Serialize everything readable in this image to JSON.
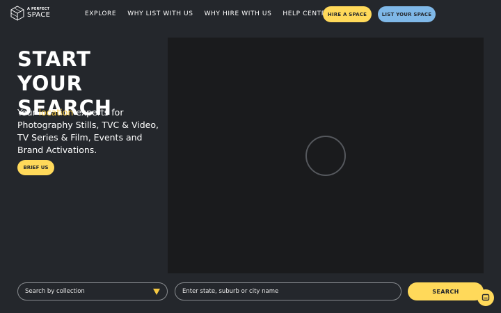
{
  "header": {
    "logo": {
      "line1": "A PERFECT",
      "line2": "SPACE",
      "icon": "cube-logo-icon"
    },
    "nav": [
      {
        "label": "EXPLORE"
      },
      {
        "label": "WHY LIST WITH US"
      },
      {
        "label": "WHY HIRE WITH US"
      },
      {
        "label": "HELP CENTRE"
      }
    ],
    "hire_button": "HIRE A SPACE",
    "list_button": "LIST YOUR SPACE"
  },
  "hero": {
    "title_line1": "START YOUR",
    "title_line2": "SEARCH",
    "desc_prefix": "Your ",
    "desc_highlight": "location",
    "desc_rest": " experts for Photography Stills, TVC & Video, TV Series & Film, Events and Brand Activations.",
    "brief_button": "BRIEF US"
  },
  "video": {
    "loading_icon": "spinner-icon"
  },
  "search": {
    "collection_placeholder": "Search by collection",
    "location_placeholder": "Enter state, suburb or city name",
    "search_button": "SEARCH"
  },
  "chat": {
    "icon": "chat-icon"
  },
  "colors": {
    "background": "#24272c",
    "accent_yellow": "#ffd95a",
    "accent_blue": "#7fb8e8",
    "highlight": "#f5c842",
    "video_bg": "#1a1b1d"
  }
}
